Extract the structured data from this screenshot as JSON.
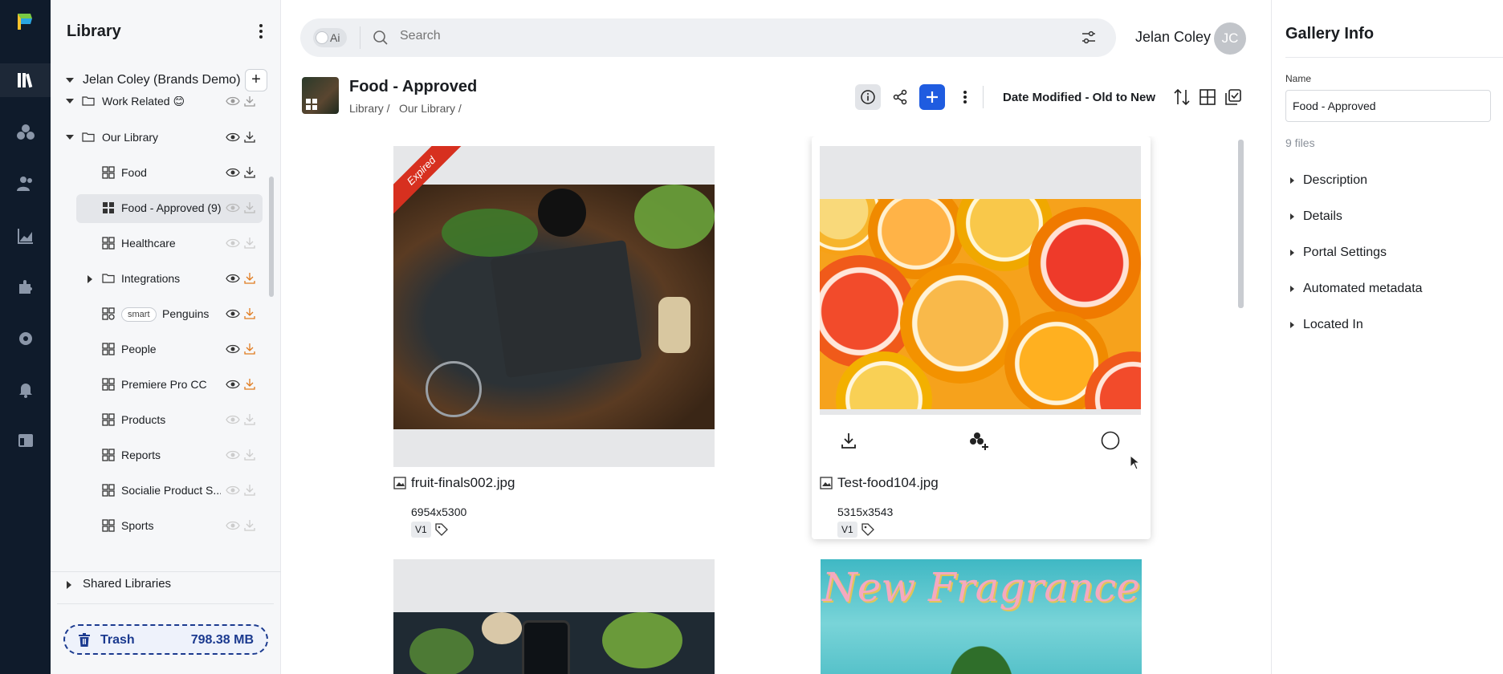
{
  "rail": {
    "icons": [
      "app-logo",
      "library-icon",
      "assets-icon",
      "users-icon",
      "analytics-icon",
      "integrations-icon",
      "settings-icon",
      "notifications-icon",
      "portals-icon"
    ]
  },
  "library": {
    "title": "Library",
    "owner": "Jelan Coley (Brands Demo)",
    "items": [
      {
        "label": "Work Related 😊",
        "type": "folder",
        "expanded": true
      },
      {
        "label": "Our Library",
        "type": "folder",
        "expanded": true
      },
      {
        "label": "Food",
        "type": "gallery"
      },
      {
        "label": "Food - Approved (9)",
        "type": "gallery",
        "selected": true
      },
      {
        "label": "Healthcare",
        "type": "gallery"
      },
      {
        "label": "Integrations",
        "type": "folder",
        "expanded": false
      },
      {
        "label": "Penguins",
        "type": "smart-gallery",
        "badge": "smart"
      },
      {
        "label": "People",
        "type": "gallery"
      },
      {
        "label": "Premiere Pro CC",
        "type": "gallery"
      },
      {
        "label": "Products",
        "type": "gallery"
      },
      {
        "label": "Reports",
        "type": "gallery"
      },
      {
        "label": "Socialie Product S...",
        "type": "gallery"
      },
      {
        "label": "Sports",
        "type": "gallery"
      }
    ],
    "shared": "Shared Libraries",
    "trash": {
      "label": "Trash",
      "size": "798.38 MB"
    }
  },
  "topbar": {
    "ai_label": "Ai",
    "search_placeholder": "Search",
    "user_name": "Jelan Coley",
    "user_initials": "JC"
  },
  "gallery": {
    "title": "Food - Approved",
    "breadcrumb": [
      "Library /",
      "Our Library /"
    ],
    "sort_label": "Date Modified - Old to New"
  },
  "assets": [
    {
      "name": "fruit-finals002.jpg",
      "dims": "6954x5300",
      "version": "V1",
      "expired_label": "Expired"
    },
    {
      "name": "Test-food104.jpg",
      "dims": "5315x3543",
      "version": "V1"
    },
    {
      "name": "",
      "dims": "",
      "version": ""
    },
    {
      "name": "",
      "dims": "",
      "version": "",
      "overlay_text": "New Fragrance"
    }
  ],
  "info_panel": {
    "title": "Gallery Info",
    "name_label": "Name",
    "name_value": "Food - Approved",
    "files_count": "9 files",
    "sections": [
      "Description",
      "Details",
      "Portal Settings",
      "Automated metadata",
      "Located In"
    ]
  },
  "colors": {
    "accent": "#1f5ce0",
    "rail": "#0f1b2b",
    "trash": "#1b3a8f",
    "expired": "#d7301f"
  }
}
